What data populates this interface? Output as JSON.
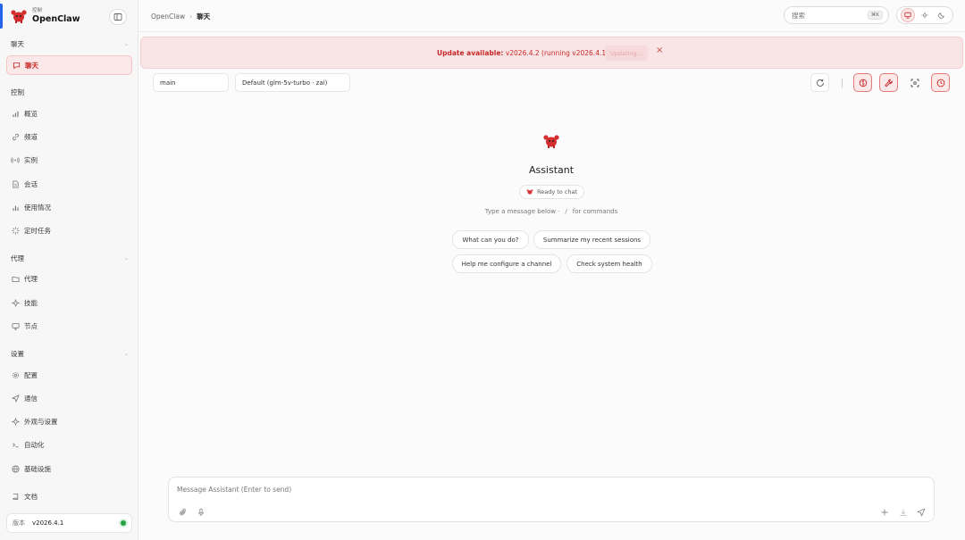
{
  "sidebar": {
    "brand_sub": "控制",
    "brand_title": "OpenClaw",
    "groups": [
      {
        "label": "聊天"
      },
      {
        "label": "控制"
      },
      {
        "label": "代理"
      },
      {
        "label": "设置"
      }
    ],
    "items": {
      "chat": "聊天",
      "overview": "概览",
      "channels": "频道",
      "instances": "实例",
      "sessions": "会话",
      "usage": "使用情况",
      "cron": "定时任务",
      "agents": "代理",
      "skills": "技能",
      "nodes": "节点",
      "config": "配置",
      "comms": "通信",
      "appearance": "外观与设置",
      "automation": "自动化",
      "infra": "基础设施",
      "docs": "文档"
    },
    "version_label": "版本",
    "version_value": "v2026.4.1"
  },
  "topbar": {
    "crumb_root": "OpenClaw",
    "crumb_current": "聊天",
    "search_placeholder": "搜索",
    "search_kbd": "⌘K"
  },
  "banner": {
    "prefix": "Update available:",
    "message": "v2026.4.2 (running v2026.4.1).",
    "button": "Updating…"
  },
  "selectors": {
    "session": "main",
    "model": "Default (glm-5v-turbo · zai)"
  },
  "center": {
    "title": "Assistant",
    "status": "Ready to chat",
    "hint_before": "Type a message below ·",
    "hint_slash": "/",
    "hint_after": "for commands",
    "suggestions": [
      "What can you do?",
      "Summarize my recent sessions",
      "Help me configure a channel",
      "Check system health"
    ]
  },
  "composer": {
    "placeholder": "Message Assistant (Enter to send)"
  },
  "colors": {
    "accent": "#c92828",
    "banner_bg": "#f9e5e6",
    "status_ok": "#22a447",
    "active_bar": "#2563eb"
  },
  "icons": {
    "logo": "lobster-logo-icon",
    "collapse": "sidebar-toggle-icon",
    "refresh": "refresh-icon",
    "brain": "brain-icon",
    "wrench": "wrench-icon",
    "focus": "focus-icon",
    "clock": "clock-icon",
    "attach": "paperclip-icon",
    "mic": "microphone-icon",
    "plus": "plus-icon",
    "download": "download-icon",
    "send": "send-icon"
  }
}
